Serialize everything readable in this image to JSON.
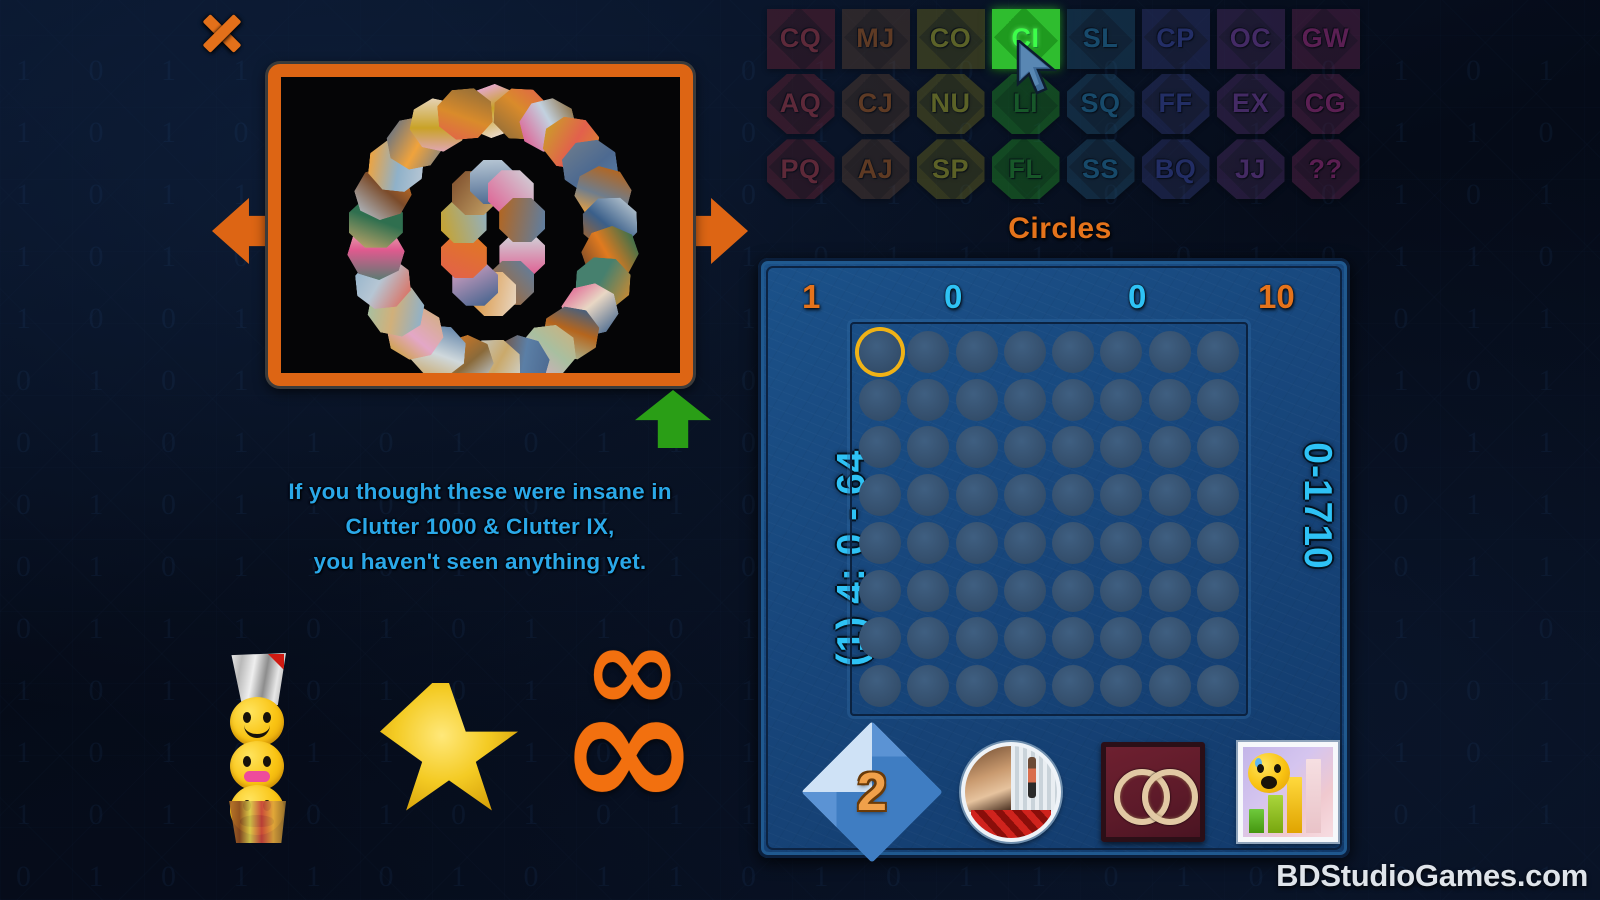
{
  "window": {
    "close_label": "X"
  },
  "preview": {
    "left_arrow_label": "previous",
    "right_arrow_label": "next",
    "up_arrow_label": "select"
  },
  "tagline": {
    "line1": "If you thought these were insane in",
    "line2": "Clutter 1000 & Clutter IX,",
    "line3": "you haven't seen anything yet."
  },
  "left_icons": {
    "emoji_stack_name": "emoji-stack-icon",
    "star_name": "star-icon",
    "infinity_name": "infinity-icon",
    "infinity_glyph": "∞"
  },
  "tile_grid": {
    "tiles": [
      {
        "label": "CQ",
        "shape": "sq",
        "mid": "#4a1c24",
        "dark": "#6d2230",
        "text": "#d2454f",
        "dim": true,
        "selected": false
      },
      {
        "label": "MJ",
        "shape": "sq",
        "mid": "#4a3526",
        "dark": "#5e4230",
        "text": "#d4701f",
        "dim": true,
        "selected": false
      },
      {
        "label": "CO",
        "shape": "sq",
        "mid": "#50501b",
        "dark": "#6e6a1c",
        "text": "#cfcf2a",
        "dim": true,
        "selected": false
      },
      {
        "label": "CI",
        "shape": "sq",
        "mid": "#1f9a1f",
        "dark": "#2fbd2f",
        "text": "#3dff4a",
        "dim": false,
        "selected": true
      },
      {
        "label": "SL",
        "shape": "sq",
        "mid": "#1e3d52",
        "dark": "#21506e",
        "text": "#2e9ad0",
        "dim": true,
        "selected": false
      },
      {
        "label": "CP",
        "shape": "sq",
        "mid": "#2b2f54",
        "dark": "#323a75",
        "text": "#4a59c6",
        "dim": true,
        "selected": false
      },
      {
        "label": "OC",
        "shape": "sq",
        "mid": "#3d2a4e",
        "dark": "#4e2f66",
        "text": "#9a52c8",
        "dim": true,
        "selected": false
      },
      {
        "label": "GW",
        "shape": "sq",
        "mid": "#4c2140",
        "dark": "#64274f",
        "text": "#d13aa0",
        "dim": true,
        "selected": false
      },
      {
        "label": "AQ",
        "shape": "oc",
        "mid": "#4a1c24",
        "dark": "#6d2230",
        "text": "#d2454f",
        "dim": true,
        "selected": false
      },
      {
        "label": "CJ",
        "shape": "oc",
        "mid": "#4a3526",
        "dark": "#5e4230",
        "text": "#d4701f",
        "dim": true,
        "selected": false
      },
      {
        "label": "NU",
        "shape": "oc",
        "mid": "#50501b",
        "dark": "#6e6a1c",
        "text": "#cfcf2a",
        "dim": true,
        "selected": false
      },
      {
        "label": "LI",
        "shape": "oc",
        "mid": "#1b7a1b",
        "dark": "#249624",
        "text": "#2db832",
        "dim": true,
        "selected": false
      },
      {
        "label": "SQ",
        "shape": "oc",
        "mid": "#1e3d52",
        "dark": "#21506e",
        "text": "#2e9ad0",
        "dim": true,
        "selected": false
      },
      {
        "label": "FF",
        "shape": "oc",
        "mid": "#2b2f54",
        "dark": "#323a75",
        "text": "#4a59c6",
        "dim": true,
        "selected": false
      },
      {
        "label": "EX",
        "shape": "oc",
        "mid": "#3d2a4e",
        "dark": "#4e2f66",
        "text": "#9a52c8",
        "dim": true,
        "selected": false
      },
      {
        "label": "CG",
        "shape": "oc",
        "mid": "#4c2140",
        "dark": "#64274f",
        "text": "#d13aa0",
        "dim": true,
        "selected": false
      },
      {
        "label": "PQ",
        "shape": "oc",
        "mid": "#4a1c24",
        "dark": "#6d2230",
        "text": "#d2454f",
        "dim": true,
        "selected": false
      },
      {
        "label": "AJ",
        "shape": "oc",
        "mid": "#4a3526",
        "dark": "#5e4230",
        "text": "#d4701f",
        "dim": true,
        "selected": false
      },
      {
        "label": "SP",
        "shape": "oc",
        "mid": "#50501b",
        "dark": "#6e6a1c",
        "text": "#cfcf2a",
        "dim": true,
        "selected": false
      },
      {
        "label": "FL",
        "shape": "oc",
        "mid": "#1b7a1b",
        "dark": "#249624",
        "text": "#2db832",
        "dim": true,
        "selected": false
      },
      {
        "label": "SS",
        "shape": "oc",
        "mid": "#1e3d52",
        "dark": "#21506e",
        "text": "#2e9ad0",
        "dim": true,
        "selected": false
      },
      {
        "label": "BQ",
        "shape": "oc",
        "mid": "#2b2f54",
        "dark": "#323a75",
        "text": "#4a59c6",
        "dim": true,
        "selected": false
      },
      {
        "label": "JJ",
        "shape": "oc",
        "mid": "#3d2a4e",
        "dark": "#4e2f66",
        "text": "#9a52c8",
        "dim": true,
        "selected": false
      },
      {
        "label": "??",
        "shape": "oc",
        "mid": "#4c2140",
        "dark": "#64274f",
        "text": "#d13aa0",
        "dim": true,
        "selected": false
      }
    ]
  },
  "board": {
    "title": "Circles",
    "axis": [
      {
        "value": "1",
        "color": "orange"
      },
      {
        "value": "0",
        "color": "cyan"
      },
      {
        "value": "0",
        "color": "cyan"
      },
      {
        "value": "10",
        "color": "orange"
      }
    ],
    "left_label": "(1) 4: 0 - 64",
    "right_label": "0-1710",
    "grid": {
      "rows": 8,
      "cols": 8,
      "highlight_row": 0,
      "highlight_col": 0
    },
    "buttons": [
      {
        "name": "level-badge-button",
        "value": "2"
      },
      {
        "name": "photo-preview-button",
        "value": ""
      },
      {
        "name": "rings-button",
        "value": ""
      },
      {
        "name": "stats-button",
        "value": ""
      }
    ]
  },
  "watermark": {
    "text": "BDStudioGames.com"
  }
}
